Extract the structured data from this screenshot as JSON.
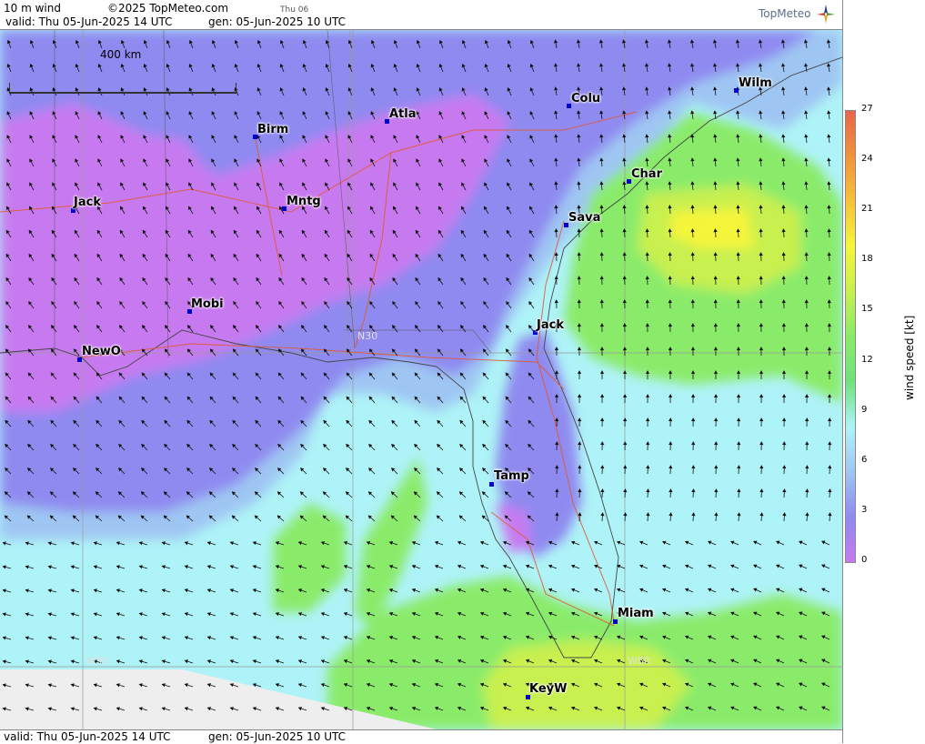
{
  "header": {
    "variable": "10 m wind",
    "copyright": "©2025 TopMeteo.com",
    "day": "Thu 06",
    "valid": "valid:  Thu  05-Jun-2025  14 UTC",
    "gen": "gen: 05-Jun-2025 10 UTC"
  },
  "footer": {
    "valid": "valid:  Thu  05-Jun-2025  14 UTC",
    "gen": "gen: 05-Jun-2025 10 UTC"
  },
  "logo": "TopMeteo",
  "scale_label": "400 km",
  "grid_labels": {
    "n30": "N30",
    "w90": "W90",
    "w80": "W80"
  },
  "cities": [
    {
      "name": "Wilm"
    },
    {
      "name": "Colu"
    },
    {
      "name": "Atla"
    },
    {
      "name": "Birm"
    },
    {
      "name": "Char"
    },
    {
      "name": "Sava"
    },
    {
      "name": "Jack"
    },
    {
      "name": "Mntg"
    },
    {
      "name": "Mobi"
    },
    {
      "name": "NewO"
    },
    {
      "name": "Jack"
    },
    {
      "name": "Tamp"
    },
    {
      "name": "Miam"
    },
    {
      "name": "KeyW"
    }
  ],
  "legend": {
    "title": "wind speed [kt]",
    "ticks": [
      "27",
      "24",
      "21",
      "18",
      "15",
      "12",
      "9",
      "6",
      "3",
      "0"
    ],
    "colors": [
      "#e8654c",
      "#f0933c",
      "#f6c23a",
      "#f5f53a",
      "#c8f050",
      "#8aeb6a",
      "#6fe27c",
      "#aef3f7",
      "#9fc6f3",
      "#8f8af0",
      "#c77af0"
    ]
  }
}
